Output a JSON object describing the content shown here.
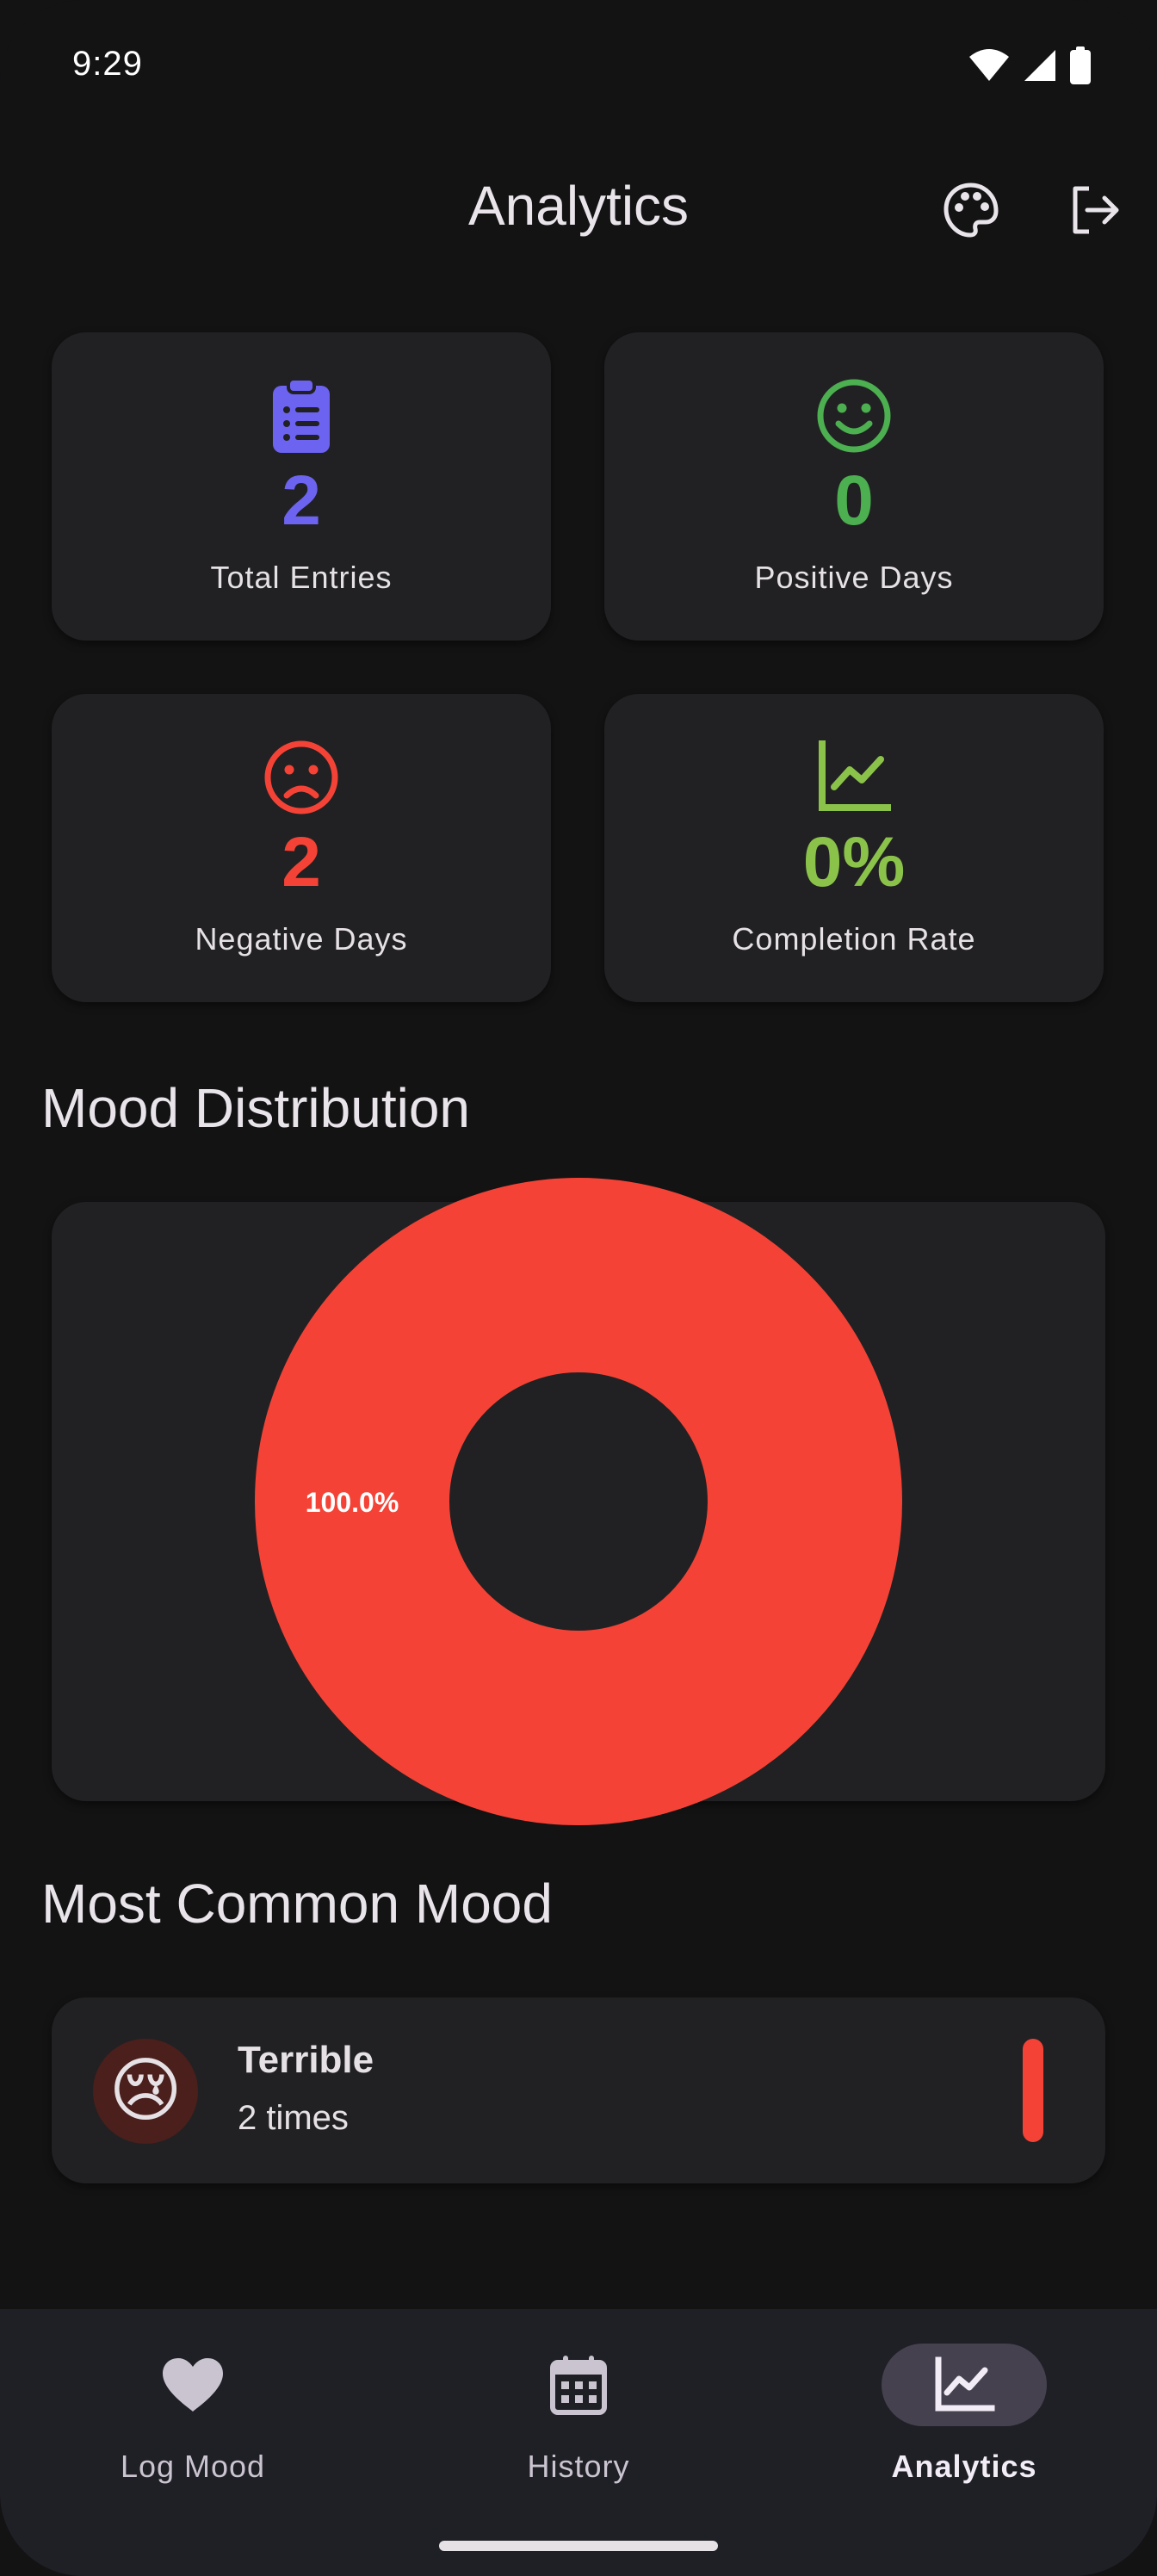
{
  "status_bar": {
    "time": "9:29",
    "icons": [
      "wifi-icon",
      "signal-icon",
      "battery-icon"
    ]
  },
  "app_bar": {
    "title": "Analytics",
    "actions": [
      "palette-icon",
      "logout-icon"
    ]
  },
  "stats": [
    {
      "icon": "clipboard-list-icon",
      "value": "2",
      "label": "Total Entries",
      "color": "#6c63f0"
    },
    {
      "icon": "smile-icon",
      "value": "0",
      "label": "Positive Days",
      "color": "#4caf50"
    },
    {
      "icon": "frown-icon",
      "value": "2",
      "label": "Negative Days",
      "color": "#f44336"
    },
    {
      "icon": "trend-chart-icon",
      "value": "0%",
      "label": "Completion Rate",
      "color": "#8bc34a"
    }
  ],
  "sections": {
    "distribution_title": "Mood Distribution",
    "common_title": "Most Common Mood"
  },
  "chart_data": {
    "type": "pie",
    "donut": true,
    "slices": [
      {
        "label": "100.0%",
        "value": 100.0,
        "color": "#f44336"
      }
    ]
  },
  "most_common_mood": {
    "emoji": "😢",
    "name": "Terrible",
    "count_text": "2 times",
    "color": "#f44336"
  },
  "bottom_nav": {
    "items": [
      {
        "icon": "heart-icon",
        "label": "Log Mood",
        "active": false
      },
      {
        "icon": "calendar-icon",
        "label": "History",
        "active": false
      },
      {
        "icon": "analytics-icon",
        "label": "Analytics",
        "active": true
      }
    ]
  },
  "colors": {
    "background": "#131314",
    "card": "#212123",
    "nav_background": "#1f1f26",
    "nav_active_pill": "#45414f"
  }
}
